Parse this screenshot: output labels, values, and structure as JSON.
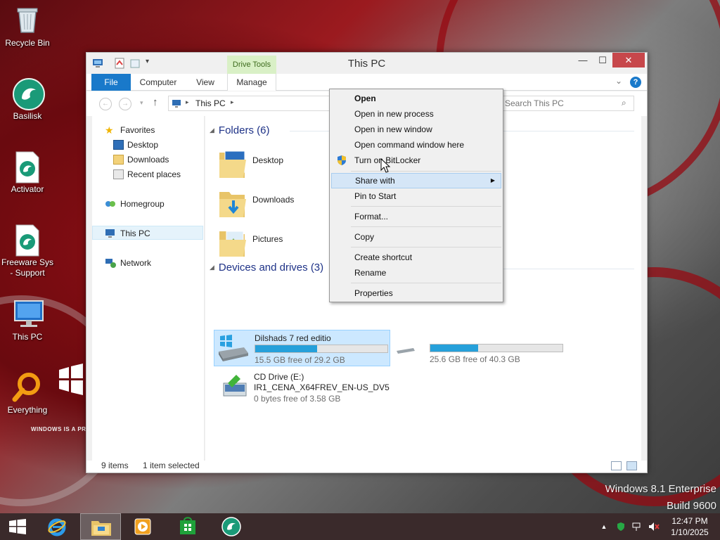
{
  "desktop": {
    "icons": [
      {
        "label": "Recycle Bin",
        "icon": "recycle-bin-icon"
      },
      {
        "label": "Basilisk",
        "icon": "basilisk-icon"
      },
      {
        "label": "Activator",
        "icon": "activator-icon"
      },
      {
        "label": "Freeware Sys - Support",
        "icon": "freeware-icon"
      },
      {
        "label": "This PC",
        "icon": "this-pc-icon"
      },
      {
        "label": "Everything",
        "icon": "everything-icon"
      }
    ],
    "watermark": "WINDOWS IS A PROUD",
    "edition_line1": "Windows 8.1 Enterprise",
    "edition_line2": "Build 9600"
  },
  "window": {
    "title": "This PC",
    "contextual_tab_group": "Drive Tools",
    "tabs": [
      "File",
      "Computer",
      "View",
      "Manage"
    ],
    "accent_color": "#1979ca",
    "address": "This PC",
    "search_placeholder": "Search This PC",
    "nav_pane": {
      "favorites": "Favorites",
      "favorites_items": [
        "Desktop",
        "Downloads",
        "Recent places"
      ],
      "homegroup": "Homegroup",
      "this_pc": "This PC",
      "network": "Network"
    },
    "folders_header": "Folders (6)",
    "folders": [
      "Desktop",
      "Downloads",
      "Pictures"
    ],
    "devices_header": "Devices and drives (3)",
    "drives": [
      {
        "name": "Dilshads 7 red editio",
        "free": "15.5 GB free of 29.2 GB",
        "used_fraction": 0.47
      },
      {
        "name": "",
        "free": "25.6 GB free of 40.3 GB",
        "used_fraction": 0.36
      },
      {
        "name": "CD Drive (E:)",
        "label": "IR1_CENA_X64FREV_EN-US_DV5",
        "free": "0 bytes free of 3.58 GB"
      }
    ],
    "status_items": "9 items",
    "status_selected": "1 item selected"
  },
  "context_menu": {
    "open": "Open",
    "open_new_process": "Open in new process",
    "open_new_window": "Open in new window",
    "open_cmd": "Open command window here",
    "bitlocker": "Turn on BitLocker",
    "share_with": "Share with",
    "pin_start": "Pin to Start",
    "format": "Format...",
    "copy": "Copy",
    "create_shortcut": "Create shortcut",
    "rename": "Rename",
    "properties": "Properties"
  },
  "taskbar": {
    "time": "12:47 PM",
    "date": "1/10/2025"
  }
}
